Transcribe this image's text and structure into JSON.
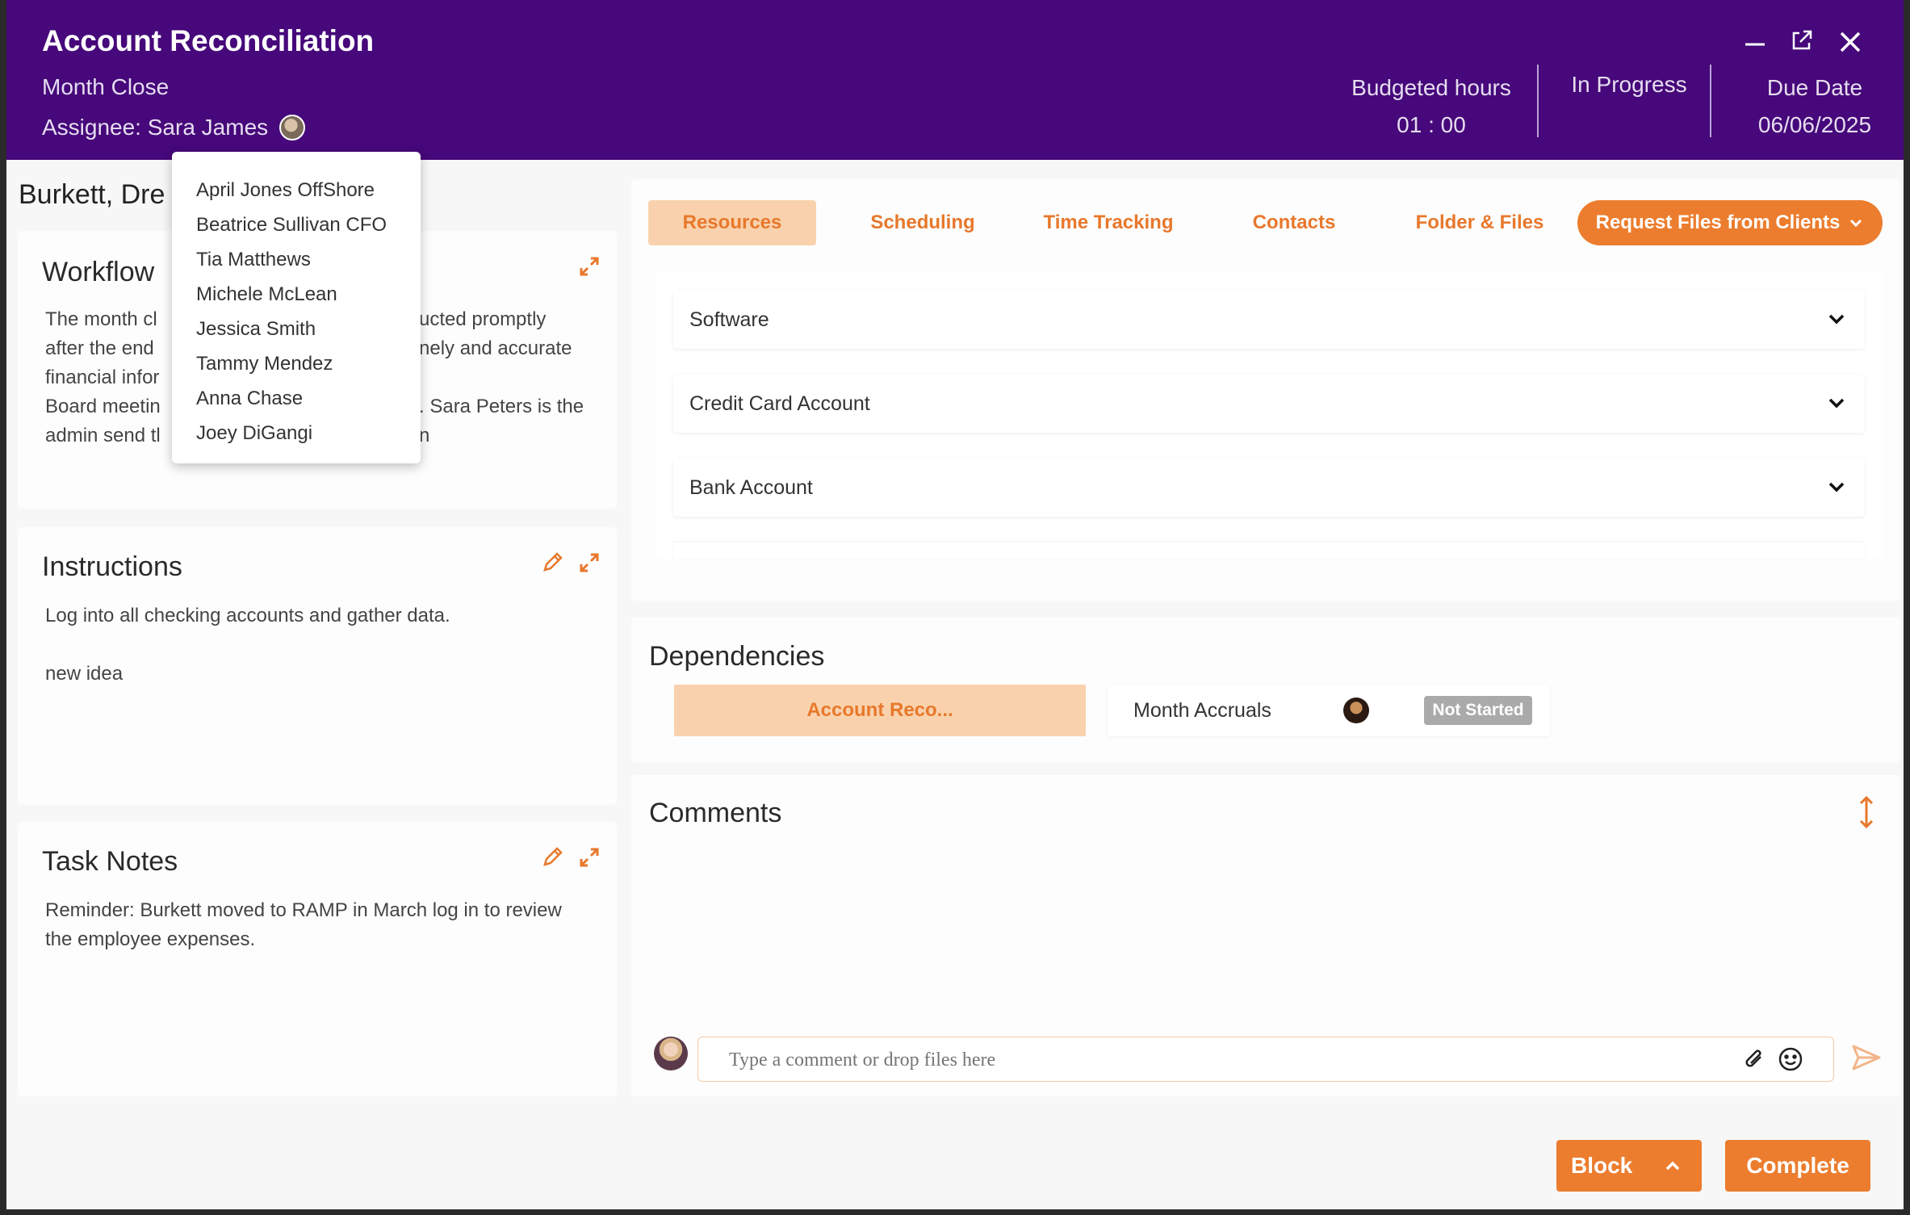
{
  "header": {
    "title": "Account Reconciliation",
    "subtitle": "Month Close",
    "assignee_label": "Assignee: Sara James",
    "budgeted_label": "Budgeted hours",
    "budgeted_value": "01 : 00",
    "status": "In Progress",
    "due_label": "Due Date",
    "due_value": "06/06/2025"
  },
  "client_name": "Burkett, Dre",
  "assignee_dropdown": {
    "options": [
      "April Jones OffShore",
      "Beatrice Sullivan CFO",
      "Tia Matthews",
      "Michele McLean",
      "Jessica Smith",
      "Tammy Mendez",
      "Anna Chase",
      "Joey DiGangi"
    ]
  },
  "workflow": {
    "title": "Workflow",
    "lines": [
      "The month cl",
      "after the end",
      "financial infor",
      "Board meetin",
      "admin send tl"
    ],
    "lines_right": [
      "ucted promptly",
      "nely and accurate",
      "",
      ". Sara Peters is the",
      "n"
    ]
  },
  "instructions": {
    "title": "Instructions",
    "line1": "Log into all checking accounts and gather data.",
    "line2": "new idea"
  },
  "task_notes": {
    "title": "Task Notes",
    "line1": "Reminder: Burkett moved to RAMP in March log in to review",
    "line2": "the employee expenses."
  },
  "tabs": [
    "Resources",
    "Scheduling",
    "Time Tracking",
    "Contacts",
    "Folder & Files"
  ],
  "request_files_label": "Request Files from Clients",
  "resources": [
    "Software",
    "Credit Card Account",
    "Bank Account"
  ],
  "dependencies": {
    "title": "Dependencies",
    "current": "Account Reco...",
    "next_name": "Month Accruals",
    "next_status": "Not Started"
  },
  "comments": {
    "title": "Comments",
    "placeholder": "Type a comment or drop files here"
  },
  "footer": {
    "block_label": "Block",
    "complete_label": "Complete"
  },
  "colors": {
    "header_bg": "#46087a",
    "accent": "#ec7d2e",
    "accent_light": "#f9d2ad"
  }
}
